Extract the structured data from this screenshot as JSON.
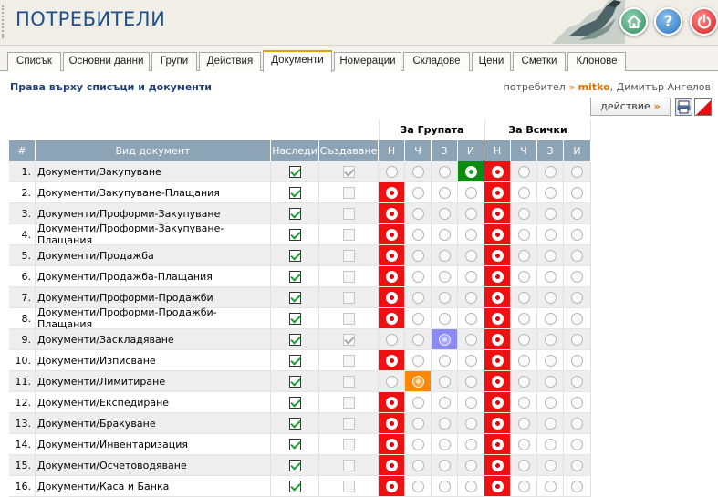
{
  "header": {
    "title": "ПОТРЕБИТЕЛИ",
    "icons": {
      "home": "home-icon",
      "help": "help-icon",
      "power": "power-icon"
    },
    "help_label": "?"
  },
  "tabs": [
    "Списък",
    "Основни данни",
    "Групи",
    "Действия",
    "Документи",
    "Номерации",
    "Складове",
    "Цени",
    "Сметки",
    "Клонове"
  ],
  "active_tab": "Документи",
  "subheader": {
    "title": "Права върху списъци и документи",
    "user_prefix": "потребител",
    "arrow": "»",
    "user_name": "mitko",
    "user_full": ", Димитър Ангелов"
  },
  "toolbar": {
    "action_label": "действие",
    "action_arrow": "»",
    "print": "print-icon",
    "excel": "excel-icon"
  },
  "table": {
    "group_headers": {
      "group": "За Групата",
      "all": "За Всички"
    },
    "columns": {
      "num": "#",
      "doc": "Вид документ",
      "inherit": "Наследи",
      "create": "Създаване",
      "g_n": "Н",
      "g_ch": "Ч",
      "g_z": "З",
      "g_i": "И",
      "a_n": "Н",
      "a_ch": "Ч",
      "a_z": "З",
      "a_i": "И"
    },
    "colors": {
      "red": "#ee1111",
      "green": "#0c8c0c",
      "blue": "#8b8bf4",
      "orange": "#ff8800",
      "header": "#8da3b6"
    },
    "rows": [
      {
        "num": "1.",
        "doc": "Документи/Закупуване",
        "inherit": true,
        "create": true,
        "create_disabled": true,
        "group": {
          "level": 3,
          "color": "green"
        },
        "all": 0
      },
      {
        "num": "2.",
        "doc": "Документи/Закупуване-Плащания",
        "inherit": true,
        "create": false,
        "create_disabled": true,
        "group": {
          "level": 0,
          "color": "red"
        },
        "all": 0
      },
      {
        "num": "3.",
        "doc": "Документи/Проформи-Закупуване",
        "inherit": true,
        "create": false,
        "create_disabled": true,
        "group": {
          "level": 0,
          "color": "red"
        },
        "all": 0
      },
      {
        "num": "4.",
        "doc": "Документи/Проформи-Закупуване-Плащания",
        "inherit": true,
        "create": false,
        "create_disabled": true,
        "group": {
          "level": 0,
          "color": "red"
        },
        "all": 0
      },
      {
        "num": "5.",
        "doc": "Документи/Продажба",
        "inherit": true,
        "create": false,
        "create_disabled": true,
        "group": {
          "level": 0,
          "color": "red"
        },
        "all": 0
      },
      {
        "num": "6.",
        "doc": "Документи/Продажба-Плащания",
        "inherit": true,
        "create": false,
        "create_disabled": true,
        "group": {
          "level": 0,
          "color": "red"
        },
        "all": 0
      },
      {
        "num": "7.",
        "doc": "Документи/Проформи-Продажби",
        "inherit": true,
        "create": false,
        "create_disabled": true,
        "group": {
          "level": 0,
          "color": "red"
        },
        "all": 0
      },
      {
        "num": "8.",
        "doc": "Документи/Проформи-Продажби-Плащания",
        "inherit": true,
        "create": false,
        "create_disabled": true,
        "group": {
          "level": 0,
          "color": "red"
        },
        "all": 0
      },
      {
        "num": "9.",
        "doc": "Документи/Заскладяване",
        "inherit": true,
        "create": true,
        "create_disabled": true,
        "group": {
          "level": 2,
          "color": "blue"
        },
        "all": 0
      },
      {
        "num": "10.",
        "doc": "Документи/Изписване",
        "inherit": true,
        "create": false,
        "create_disabled": true,
        "group": {
          "level": 0,
          "color": "red"
        },
        "all": 0
      },
      {
        "num": "11.",
        "doc": "Документи/Лимитиране",
        "inherit": true,
        "create": false,
        "create_disabled": true,
        "group": {
          "level": 1,
          "color": "orange"
        },
        "all": 0
      },
      {
        "num": "12.",
        "doc": "Документи/Експедиране",
        "inherit": true,
        "create": false,
        "create_disabled": true,
        "group": {
          "level": 0,
          "color": "red"
        },
        "all": 0
      },
      {
        "num": "13.",
        "doc": "Документи/Бракуване",
        "inherit": true,
        "create": false,
        "create_disabled": true,
        "group": {
          "level": 0,
          "color": "red"
        },
        "all": 0
      },
      {
        "num": "14.",
        "doc": "Документи/Инвентаризация",
        "inherit": true,
        "create": false,
        "create_disabled": true,
        "group": {
          "level": 0,
          "color": "red"
        },
        "all": 0
      },
      {
        "num": "15.",
        "doc": "Документи/Осчетоводяване",
        "inherit": true,
        "create": false,
        "create_disabled": true,
        "group": {
          "level": 0,
          "color": "red"
        },
        "all": 0
      },
      {
        "num": "16.",
        "doc": "Документи/Каса и Банка",
        "inherit": true,
        "create": false,
        "create_disabled": true,
        "group": {
          "level": 0,
          "color": "red"
        },
        "all": 0
      }
    ]
  }
}
